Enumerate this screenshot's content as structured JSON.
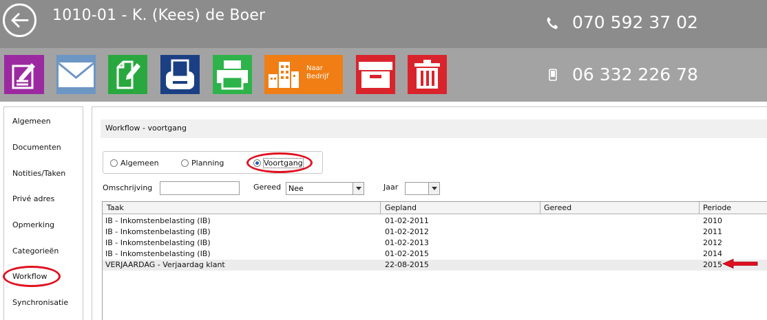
{
  "header": {
    "client_title": "1010-01 - K. (Kees) de Boer",
    "phone": "070 592 37 02",
    "mobile": "06 332 226 78"
  },
  "toolbar": {
    "buttons": [
      {
        "icon": "note-edit-icon",
        "color": "#9b2aa1"
      },
      {
        "icon": "mail-icon",
        "color": "#6c96c4"
      },
      {
        "icon": "document-edit-icon",
        "color": "#29a83f"
      },
      {
        "icon": "scanner-icon",
        "color": "#1b3f83"
      },
      {
        "icon": "printer-icon",
        "color": "#2db34a"
      },
      {
        "icon": "building-icon",
        "color": "#f07e14",
        "caption_line1": "Naar",
        "caption_line2": "Bedrijf"
      },
      {
        "icon": "archive-icon",
        "color": "#d9242c"
      },
      {
        "icon": "trash-icon",
        "color": "#d9242c"
      }
    ]
  },
  "sidebar": {
    "items": [
      {
        "label": "Algemeen"
      },
      {
        "label": "Documenten"
      },
      {
        "label": "Notities/Taken"
      },
      {
        "label": "Privé adres"
      },
      {
        "label": "Opmerking"
      },
      {
        "label": "Categorieën"
      },
      {
        "label": "Workflow",
        "active": true
      },
      {
        "label": "Synchronisatie"
      }
    ]
  },
  "main": {
    "section_title": "Workflow - voortgang",
    "radios": [
      {
        "label": "Algemeen",
        "checked": false
      },
      {
        "label": "Planning",
        "checked": false
      },
      {
        "label": "Voortgang",
        "checked": true
      }
    ],
    "filters": {
      "omschrijving_label": "Omschrijving",
      "omschrijving_value": "",
      "gereed_label": "Gereed",
      "gereed_value": "Nee",
      "jaar_label": "Jaar",
      "jaar_value": ""
    },
    "table": {
      "columns": [
        "Taak",
        "Gepland",
        "Gereed",
        "Periode"
      ],
      "rows": [
        {
          "taak": "IB - Inkomstenbelasting (IB)",
          "gepland": "01-02-2011",
          "gereed": "",
          "periode": "2010"
        },
        {
          "taak": "IB - Inkomstenbelasting (IB)",
          "gepland": "01-02-2012",
          "gereed": "",
          "periode": "2011"
        },
        {
          "taak": "IB - Inkomstenbelasting (IB)",
          "gepland": "01-02-2013",
          "gereed": "",
          "periode": "2012"
        },
        {
          "taak": "IB - Inkomstenbelasting (IB)",
          "gepland": "01-02-2015",
          "gereed": "",
          "periode": "2014"
        },
        {
          "taak": "VERJAARDAG - Verjaardag klant",
          "gepland": "22-08-2015",
          "gereed": "",
          "periode": "2015",
          "highlighted": true
        }
      ]
    }
  },
  "colors": {
    "header_bg": "#8c8c8c",
    "toolbar_bg": "#a3a3a3",
    "annotation_red": "#e01020"
  }
}
